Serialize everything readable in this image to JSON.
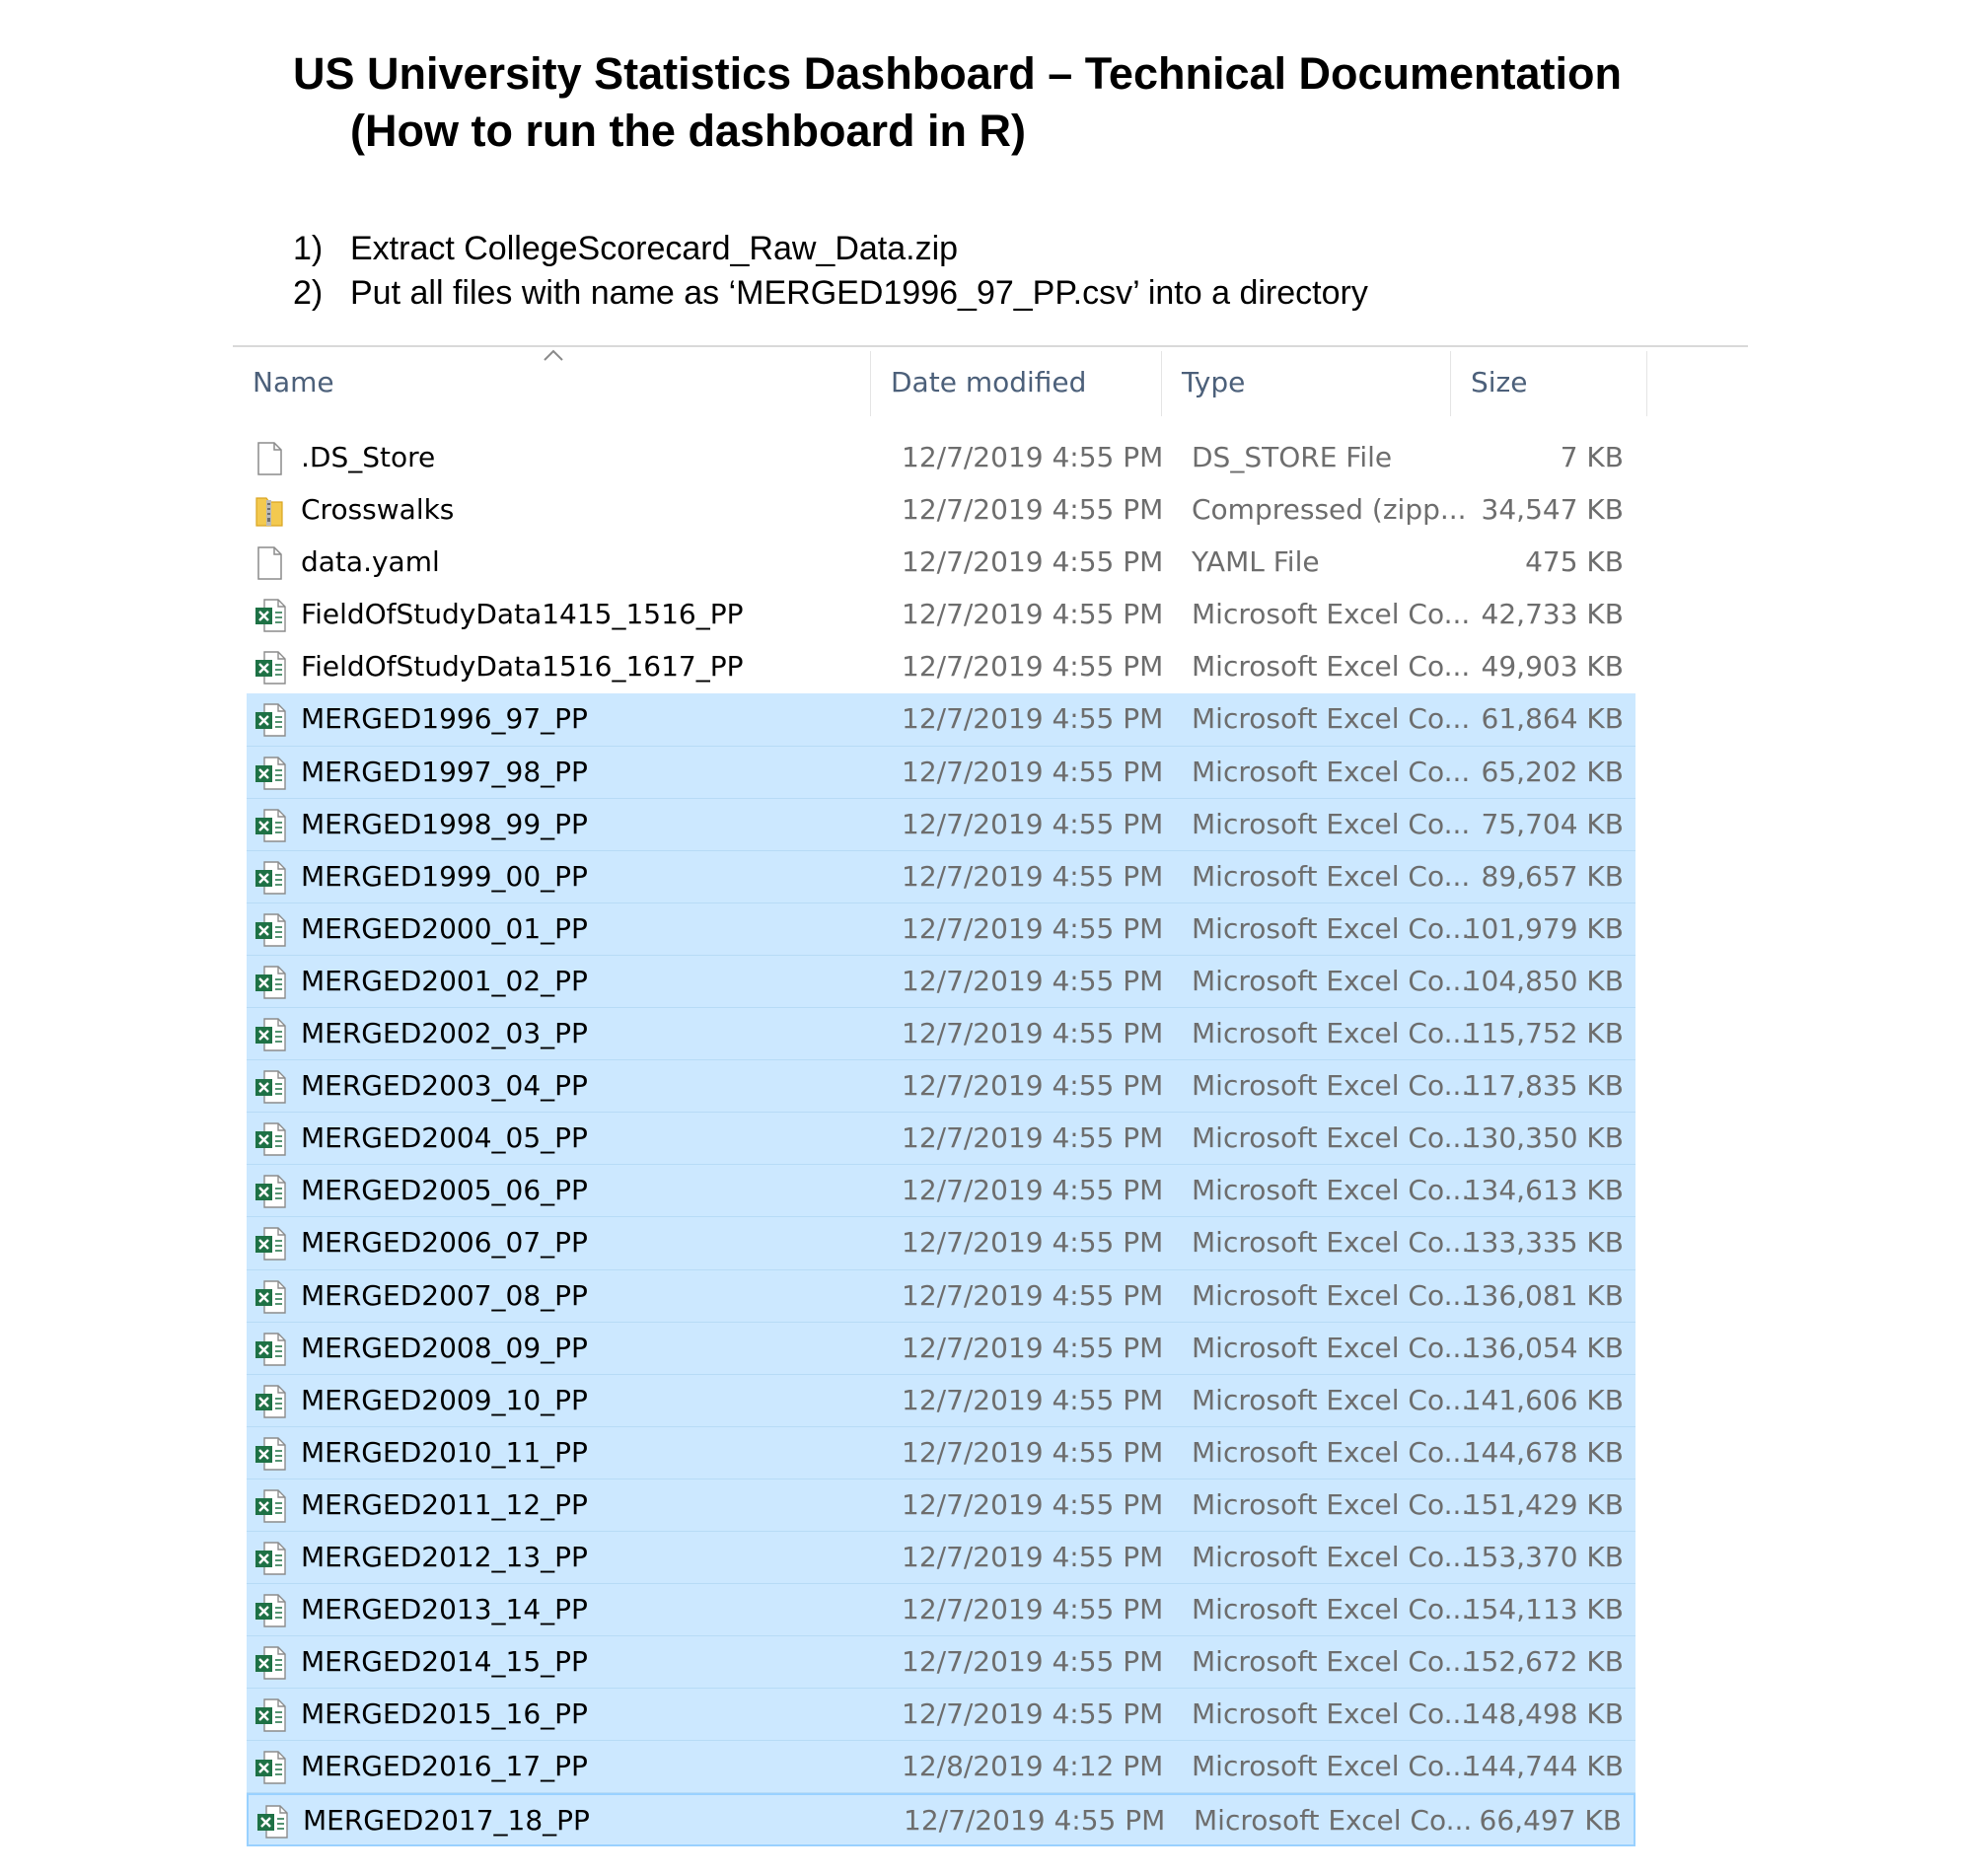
{
  "document": {
    "title_line1": "US University Statistics Dashboard – Technical Documentation",
    "title_line2": "(How to run the dashboard in R)",
    "steps": [
      {
        "number": "1)",
        "text": "Extract CollegeScorecard_Raw_Data.zip"
      },
      {
        "number": "2)",
        "text": "Put all files with name as ‘MERGED1996_97_PP.csv’ into a directory"
      }
    ]
  },
  "explorer": {
    "columns": {
      "name": "Name",
      "date": "Date modified",
      "type": "Type",
      "size": "Size"
    },
    "sort_indicator_icon": "chevron-up-icon",
    "selection_color": "#cce8ff",
    "files": [
      {
        "icon": "blank-file-icon",
        "name": ".DS_Store",
        "date": "12/7/2019 4:55 PM",
        "type": "DS_STORE File",
        "size": "7 KB",
        "selected": false
      },
      {
        "icon": "zip-folder-icon",
        "name": "Crosswalks",
        "date": "12/7/2019 4:55 PM",
        "type": "Compressed (zipp...",
        "size": "34,547 KB",
        "selected": false
      },
      {
        "icon": "blank-file-icon",
        "name": "data.yaml",
        "date": "12/7/2019 4:55 PM",
        "type": "YAML File",
        "size": "475 KB",
        "selected": false
      },
      {
        "icon": "excel-file-icon",
        "name": "FieldOfStudyData1415_1516_PP",
        "date": "12/7/2019 4:55 PM",
        "type": "Microsoft Excel Co...",
        "size": "42,733 KB",
        "selected": false
      },
      {
        "icon": "excel-file-icon",
        "name": "FieldOfStudyData1516_1617_PP",
        "date": "12/7/2019 4:55 PM",
        "type": "Microsoft Excel Co...",
        "size": "49,903 KB",
        "selected": false
      },
      {
        "icon": "excel-file-icon",
        "name": "MERGED1996_97_PP",
        "date": "12/7/2019 4:55 PM",
        "type": "Microsoft Excel Co...",
        "size": "61,864 KB",
        "selected": true
      },
      {
        "icon": "excel-file-icon",
        "name": "MERGED1997_98_PP",
        "date": "12/7/2019 4:55 PM",
        "type": "Microsoft Excel Co...",
        "size": "65,202 KB",
        "selected": true
      },
      {
        "icon": "excel-file-icon",
        "name": "MERGED1998_99_PP",
        "date": "12/7/2019 4:55 PM",
        "type": "Microsoft Excel Co...",
        "size": "75,704 KB",
        "selected": true
      },
      {
        "icon": "excel-file-icon",
        "name": "MERGED1999_00_PP",
        "date": "12/7/2019 4:55 PM",
        "type": "Microsoft Excel Co...",
        "size": "89,657 KB",
        "selected": true
      },
      {
        "icon": "excel-file-icon",
        "name": "MERGED2000_01_PP",
        "date": "12/7/2019 4:55 PM",
        "type": "Microsoft Excel Co...",
        "size": "101,979 KB",
        "selected": true
      },
      {
        "icon": "excel-file-icon",
        "name": "MERGED2001_02_PP",
        "date": "12/7/2019 4:55 PM",
        "type": "Microsoft Excel Co...",
        "size": "104,850 KB",
        "selected": true
      },
      {
        "icon": "excel-file-icon",
        "name": "MERGED2002_03_PP",
        "date": "12/7/2019 4:55 PM",
        "type": "Microsoft Excel Co...",
        "size": "115,752 KB",
        "selected": true
      },
      {
        "icon": "excel-file-icon",
        "name": "MERGED2003_04_PP",
        "date": "12/7/2019 4:55 PM",
        "type": "Microsoft Excel Co...",
        "size": "117,835 KB",
        "selected": true
      },
      {
        "icon": "excel-file-icon",
        "name": "MERGED2004_05_PP",
        "date": "12/7/2019 4:55 PM",
        "type": "Microsoft Excel Co...",
        "size": "130,350 KB",
        "selected": true
      },
      {
        "icon": "excel-file-icon",
        "name": "MERGED2005_06_PP",
        "date": "12/7/2019 4:55 PM",
        "type": "Microsoft Excel Co...",
        "size": "134,613 KB",
        "selected": true
      },
      {
        "icon": "excel-file-icon",
        "name": "MERGED2006_07_PP",
        "date": "12/7/2019 4:55 PM",
        "type": "Microsoft Excel Co...",
        "size": "133,335 KB",
        "selected": true
      },
      {
        "icon": "excel-file-icon",
        "name": "MERGED2007_08_PP",
        "date": "12/7/2019 4:55 PM",
        "type": "Microsoft Excel Co...",
        "size": "136,081 KB",
        "selected": true
      },
      {
        "icon": "excel-file-icon",
        "name": "MERGED2008_09_PP",
        "date": "12/7/2019 4:55 PM",
        "type": "Microsoft Excel Co...",
        "size": "136,054 KB",
        "selected": true
      },
      {
        "icon": "excel-file-icon",
        "name": "MERGED2009_10_PP",
        "date": "12/7/2019 4:55 PM",
        "type": "Microsoft Excel Co...",
        "size": "141,606 KB",
        "selected": true
      },
      {
        "icon": "excel-file-icon",
        "name": "MERGED2010_11_PP",
        "date": "12/7/2019 4:55 PM",
        "type": "Microsoft Excel Co...",
        "size": "144,678 KB",
        "selected": true
      },
      {
        "icon": "excel-file-icon",
        "name": "MERGED2011_12_PP",
        "date": "12/7/2019 4:55 PM",
        "type": "Microsoft Excel Co...",
        "size": "151,429 KB",
        "selected": true
      },
      {
        "icon": "excel-file-icon",
        "name": "MERGED2012_13_PP",
        "date": "12/7/2019 4:55 PM",
        "type": "Microsoft Excel Co...",
        "size": "153,370 KB",
        "selected": true
      },
      {
        "icon": "excel-file-icon",
        "name": "MERGED2013_14_PP",
        "date": "12/7/2019 4:55 PM",
        "type": "Microsoft Excel Co...",
        "size": "154,113 KB",
        "selected": true
      },
      {
        "icon": "excel-file-icon",
        "name": "MERGED2014_15_PP",
        "date": "12/7/2019 4:55 PM",
        "type": "Microsoft Excel Co...",
        "size": "152,672 KB",
        "selected": true
      },
      {
        "icon": "excel-file-icon",
        "name": "MERGED2015_16_PP",
        "date": "12/7/2019 4:55 PM",
        "type": "Microsoft Excel Co...",
        "size": "148,498 KB",
        "selected": true
      },
      {
        "icon": "excel-file-icon",
        "name": "MERGED2016_17_PP",
        "date": "12/8/2019 4:12 PM",
        "type": "Microsoft Excel Co...",
        "size": "144,744 KB",
        "selected": true
      },
      {
        "icon": "excel-file-icon",
        "name": "MERGED2017_18_PP",
        "date": "12/7/2019 4:55 PM",
        "type": "Microsoft Excel Co...",
        "size": "66,497 KB",
        "selected": true,
        "focused": true
      }
    ]
  }
}
